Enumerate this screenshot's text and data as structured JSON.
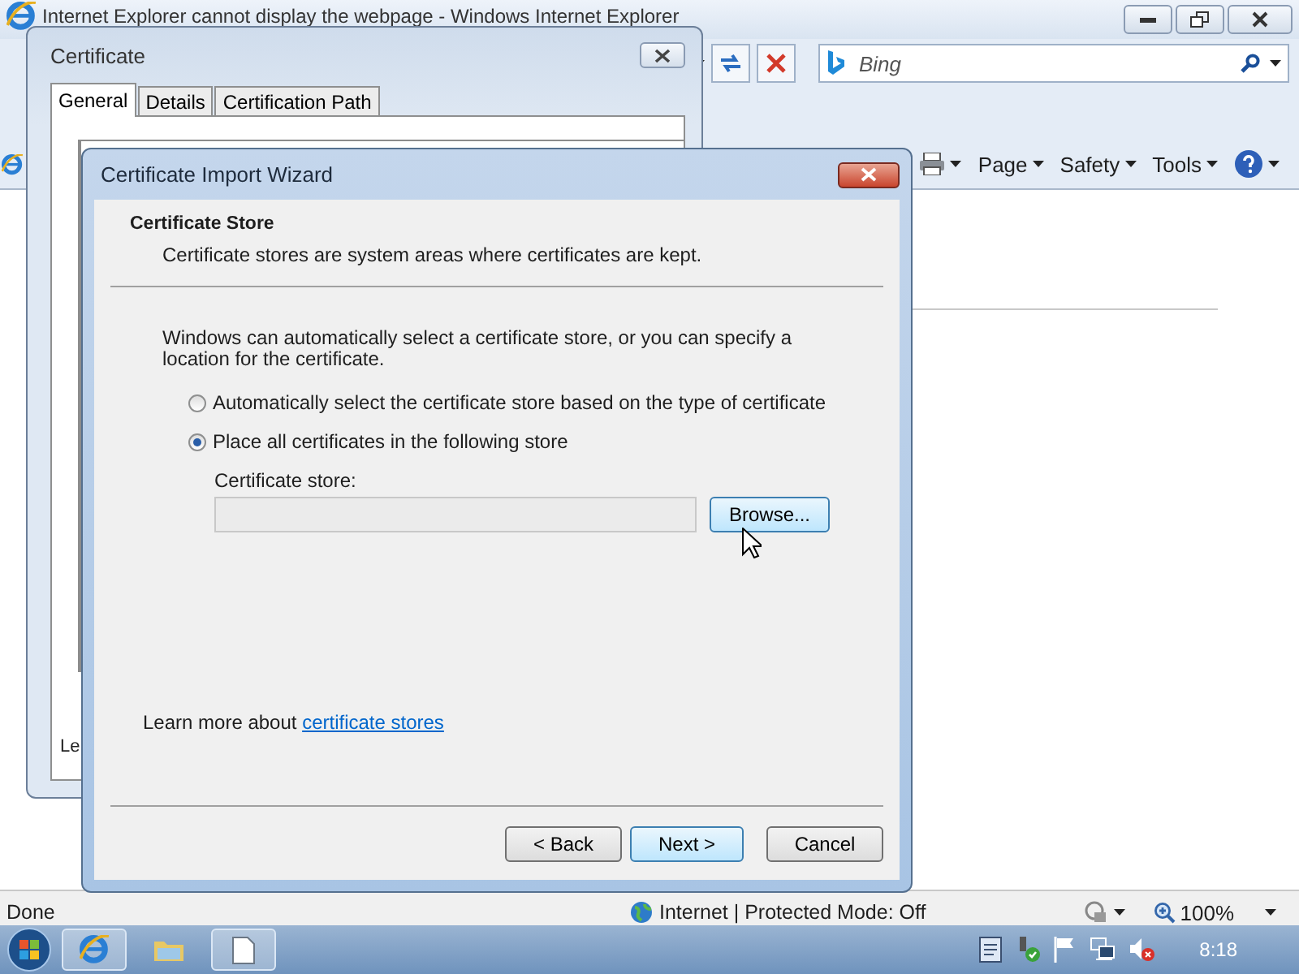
{
  "browser": {
    "title": "Internet Explorer cannot display the webpage - Windows Internet Explorer",
    "search": {
      "placeholder": "Bing"
    },
    "command_bar": [
      "Page",
      "Safety",
      "Tools"
    ],
    "status_bar": {
      "status": "Done",
      "zone": "Internet | Protected Mode: Off",
      "zoom": "100%"
    }
  },
  "certificate_dialog": {
    "title": "Certificate",
    "tabs": [
      {
        "label": "General",
        "selected": true
      },
      {
        "label": "Details",
        "selected": false
      },
      {
        "label": "Certification Path",
        "selected": false
      }
    ],
    "cut_text": "Le"
  },
  "wizard": {
    "title": "Certificate Import Wizard",
    "heading": "Certificate Store",
    "subheading": "Certificate stores are system areas where certificates are kept.",
    "description": "Windows can automatically select a certificate store, or you can specify a location for the certificate.",
    "options": [
      {
        "label": "Automatically select the certificate store based on the type of certificate",
        "selected": false
      },
      {
        "label": "Place all certificates in the following store",
        "selected": true
      }
    ],
    "store_label": "Certificate store:",
    "browse_button": "Browse...",
    "learn_more": {
      "text": "Learn more about ",
      "link": "certificate stores"
    },
    "buttons": [
      {
        "label": "< Back",
        "default": false
      },
      {
        "label": "Next >",
        "default": true
      },
      {
        "label": "Cancel",
        "default": false
      }
    ]
  },
  "taskbar": {
    "buttons": [
      {
        "kind": "browser",
        "open": true
      },
      {
        "kind": "folder",
        "open": false
      },
      {
        "kind": "document",
        "open": true
      }
    ],
    "clock": "8:18"
  }
}
